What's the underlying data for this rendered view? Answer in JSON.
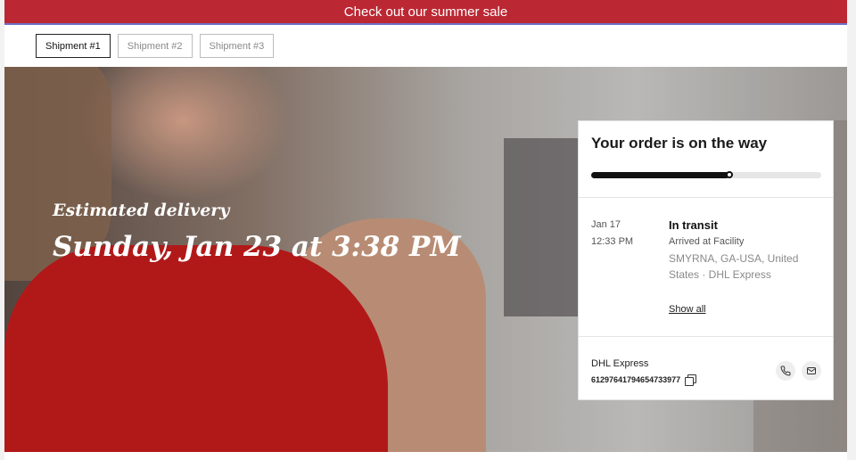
{
  "banner": {
    "text": "Check out our summer sale"
  },
  "tabs": [
    {
      "label": "Shipment #1",
      "active": true
    },
    {
      "label": "Shipment #2",
      "active": false
    },
    {
      "label": "Shipment #3",
      "active": false
    }
  ],
  "hero": {
    "estimated_label": "Estimated delivery",
    "estimated_date": "Sunday, Jan 23 at 3:38 PM"
  },
  "order_card": {
    "title": "Your order is on the way",
    "progress": 0.6,
    "event": {
      "date": "Jan 17",
      "time": "12:33 PM",
      "status": "In transit",
      "detail": "Arrived at Facility",
      "location": "SMYRNA, GA-USA, United States · DHL Express"
    },
    "show_all_label": "Show all",
    "carrier": "DHL Express",
    "tracking_number": "612976417946547339​77"
  },
  "icons": [
    "copy-icon",
    "phone-icon",
    "mail-icon"
  ],
  "colors": {
    "banner": "#bb2833",
    "accent": "#111111"
  }
}
